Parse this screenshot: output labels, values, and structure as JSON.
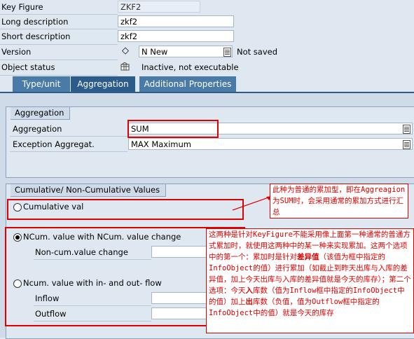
{
  "header": {
    "key_figure_label": "Key Figure",
    "key_figure_value": "ZKF2",
    "long_desc_label": "Long description",
    "long_desc_value": "zkf2",
    "short_desc_label": "Short description",
    "short_desc_value": "zkf2",
    "version_label": "Version",
    "version_value": "N New",
    "version_status": "Not saved",
    "object_status_label": "Object status",
    "object_status_value": "Inactive, not executable"
  },
  "tabs": [
    {
      "label": "Type/unit",
      "active": false
    },
    {
      "label": "Aggregation",
      "active": true
    },
    {
      "label": "Additional Properties",
      "active": false
    }
  ],
  "aggregation_group": {
    "title": "Aggregation",
    "aggregation_label": "Aggregation",
    "aggregation_value": "SUM",
    "exception_label": "Exception Aggregat.",
    "exception_value": "MAX Maximum"
  },
  "cumulative_group": {
    "title": "Cumulative/ Non-Cumulative Values",
    "option1": "Cumulative val",
    "option2": "NCum. value with NCum. value change",
    "noncum_change_label": "Non-cum.value change",
    "option3": "Ncum. value with in- and out- flow",
    "inflow_label": "Inflow",
    "outflow_label": "Outflow",
    "selected": "option2"
  },
  "annotations": {
    "note1": "此种为普通的累加型，即在Aggreagion为SUM时，会采用通常的累加方式进行汇总",
    "note2_a": "这两种是针对KeyFigure不能采用像上面第一种通常的普通方式累加时，就使用这两种中的某一种来实现累加。这两个选项中的第一个：累加时是针对",
    "note2_b": "差异值",
    "note2_c": "（该值为框中指定的InfoObject的值）进行累加（如截止到昨天出库与入库的差异值，加上今天出库与入库的差异值就是今天的库存）；第二个选项：今天",
    "note2_d": "入",
    "note2_e": "库数（值为Inflow框中指定的InfoObject中的值）加上",
    "note2_f": "出",
    "note2_g": "库数（负值，值为Outflow框中指定的InfoObject中的值）就是今天的库存"
  },
  "colors": {
    "tab_active": "#2c5c8c",
    "tab_inactive": "#4a7aa8",
    "annotation": "#e00000"
  }
}
